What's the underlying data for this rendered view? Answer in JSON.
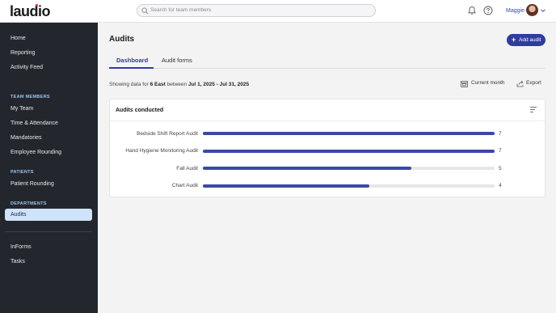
{
  "brand": {
    "logo_text": "laudio"
  },
  "header": {
    "search_placeholder": "Search for team members",
    "user_name": "Maggie"
  },
  "sidebar": {
    "items_top": [
      {
        "label": "Home"
      },
      {
        "label": "Reporting"
      },
      {
        "label": "Activity Feed"
      }
    ],
    "section_team": "TEAM MEMBERS",
    "items_team": [
      {
        "label": "My Team"
      },
      {
        "label": "Time & Attendance"
      },
      {
        "label": "Mandatories"
      },
      {
        "label": "Employee Rounding"
      }
    ],
    "section_patients": "PATIENTS",
    "items_patients": [
      {
        "label": "Patient Rounding"
      }
    ],
    "section_departments": "DEPARTMENTS",
    "items_departments": [
      {
        "label": "Audits",
        "active": true
      }
    ],
    "items_bottom": [
      {
        "label": "InForms"
      },
      {
        "label": "Tasks"
      }
    ]
  },
  "main": {
    "title": "Audits",
    "add_button": "Add audit",
    "tabs": [
      {
        "label": "Dashboard",
        "active": true
      },
      {
        "label": "Audit forms",
        "active": false
      }
    ],
    "showing_prefix": "Showing data for",
    "showing_unit": "6 East",
    "showing_between": "between",
    "showing_range": "Jul 1, 2025 - Jul 31, 2025",
    "current_month": "Current month",
    "export": "Export"
  },
  "chart_data": {
    "type": "bar",
    "title": "Audits conducted",
    "categories": [
      "Bedside Shift Report Audit",
      "Hand Hygiene Monitoring Audit",
      "Fall Audit",
      "Chart Audit"
    ],
    "values": [
      7,
      7,
      5,
      4
    ],
    "max": 7
  },
  "colors": {
    "accent": "#2f3c9e",
    "sidebar": "#23272d",
    "active_item": "#cfe3fb"
  }
}
